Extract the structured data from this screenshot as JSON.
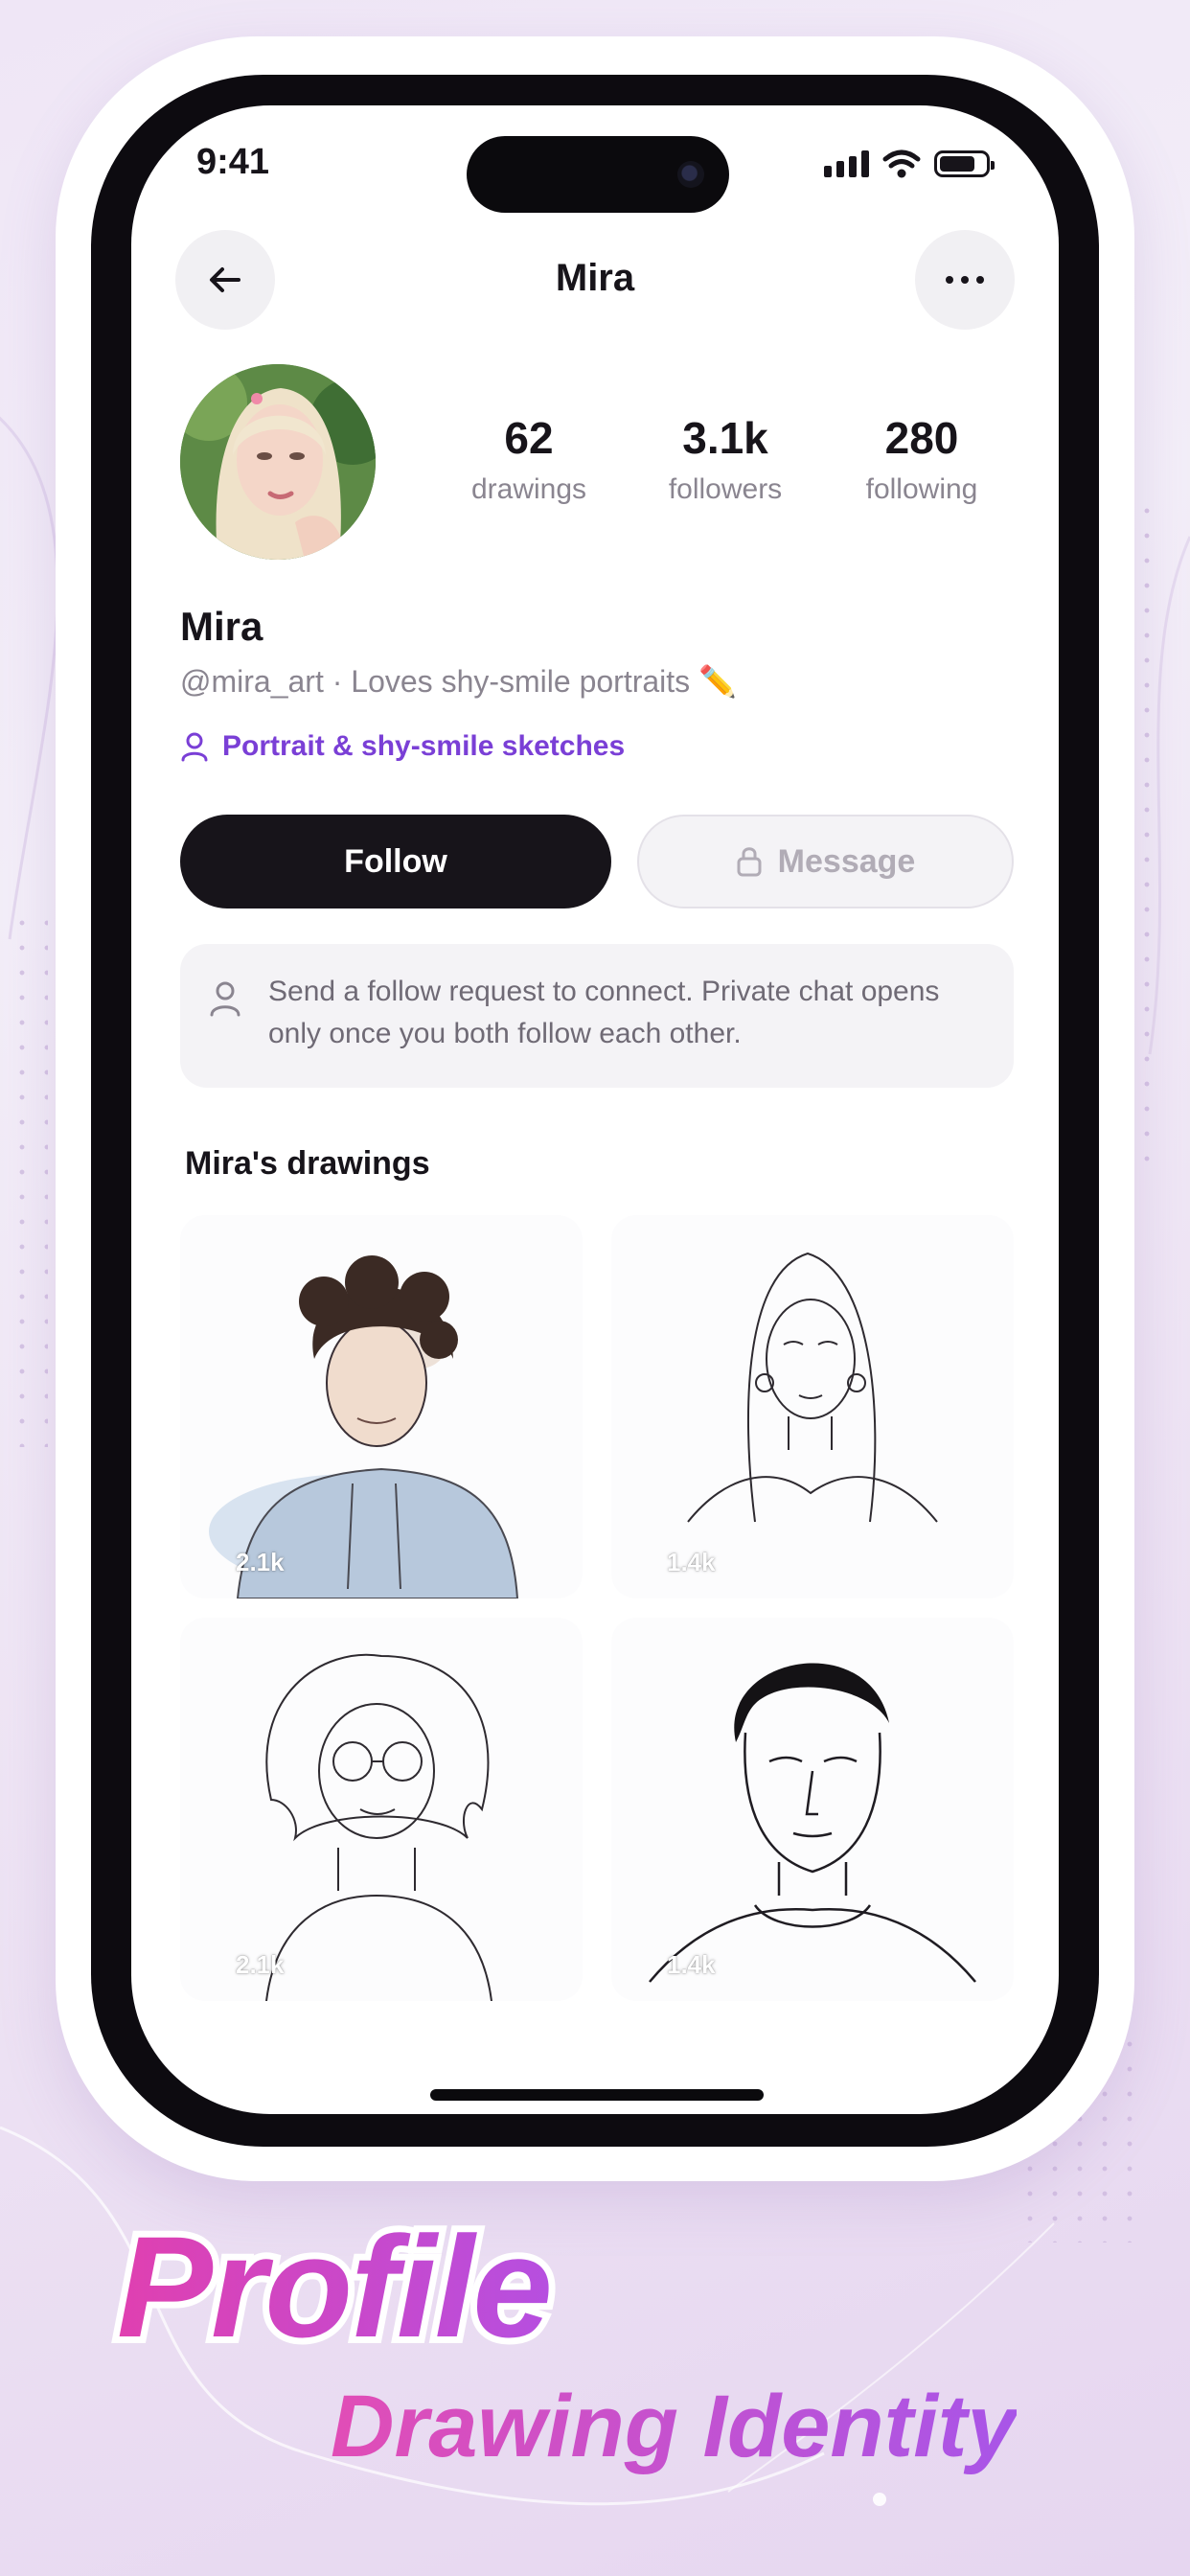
{
  "status": {
    "time": "9:41"
  },
  "nav": {
    "title": "Mira"
  },
  "profile": {
    "name": "Mira",
    "bio": "@mira_art · Loves shy-smile portraits ✏️",
    "tag": "Portrait & shy-smile sketches",
    "stats": [
      {
        "value": "62",
        "label": "drawings"
      },
      {
        "value": "3.1k",
        "label": "followers"
      },
      {
        "value": "280",
        "label": "following"
      }
    ]
  },
  "actions": {
    "follow_label": "Follow",
    "message_label": "Message"
  },
  "notice": {
    "text": "Send a follow request to connect. Private chat opens only once you both follow each other."
  },
  "drawings": {
    "title": "Mira's drawings",
    "items": [
      {
        "subject": "curly-haired man in hoodie",
        "count": "2.1k"
      },
      {
        "subject": "long-haired woman line sketch",
        "count": "1.4k"
      },
      {
        "subject": "woman with glasses sketch",
        "count": "2.1k"
      },
      {
        "subject": "man with slick hair sketch",
        "count": "1.4k"
      }
    ]
  },
  "promo": {
    "headline": "Profile",
    "subline": "Drawing Identity"
  },
  "colors": {
    "accent": "#7a3fd6",
    "dark": "#17141a",
    "headline_start": "#e040b0",
    "headline_end": "#b64fe0"
  }
}
